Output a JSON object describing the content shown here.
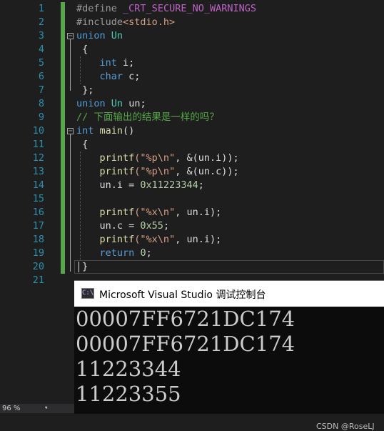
{
  "editor": {
    "line_numbers": [
      "1",
      "2",
      "3",
      "4",
      "5",
      "6",
      "7",
      "8",
      "9",
      "10",
      "11",
      "12",
      "13",
      "14",
      "15",
      "16",
      "17",
      "18",
      "19",
      "20",
      "21"
    ],
    "code": {
      "l1_kw": "#define",
      "l1_macro": "_CRT_SECURE_NO_WARNINGS",
      "l2_kw": "#include",
      "l2_file": "<stdio.h>",
      "l3_kw": "union",
      "l3_name": "Un",
      "l4": "{",
      "l5_type": "int",
      "l5_var": "i;",
      "l6_type": "char",
      "l6_var": "c;",
      "l7": "};",
      "l8_kw": "union",
      "l8_name": "Un",
      "l8_var": "un;",
      "l9_comment": "// 下面输出的结果是一样的吗？",
      "l10_type": "int",
      "l10_fn": "main",
      "l10_rest": "()",
      "l11": "{",
      "l12_fn": "printf",
      "l12_fmt": "(\"%p\\n\"",
      "l12_rest": ", &(un.i));",
      "l13_fn": "printf",
      "l13_fmt": "(\"%p\\n\"",
      "l13_rest": ", &(un.c));",
      "l14_lhs": "un.i = ",
      "l14_num": "0x11223344",
      "l14_end": ";",
      "l16_fn": "printf",
      "l16_fmt": "(\"%x\\n\"",
      "l16_rest": ", un.i);",
      "l17_lhs": "un.c = ",
      "l17_num": "0x55",
      "l17_end": ";",
      "l18_fn": "printf",
      "l18_fmt": "(\"%x\\n\"",
      "l18_rest": ", un.i);",
      "l19_kw": "return",
      "l19_num": "0",
      "l19_end": ";",
      "l20": "}"
    },
    "fold_open_symbol": "−"
  },
  "console": {
    "icon_text": "C:\\",
    "title": "Microsoft Visual Studio 调试控制台",
    "output_lines": [
      "00007FF6721DC174",
      "00007FF6721DC174",
      "11223344",
      "11223355"
    ],
    "watermark": "CSDN @RoseLJ"
  },
  "status": {
    "zoom": "96 %",
    "zoom_caret": "▾"
  },
  "colors": {
    "background": "#1e1e1e",
    "keyword": "#569cd6",
    "type": "#4ec9b0",
    "function": "#dcdcaa",
    "string": "#d69d85",
    "number": "#b5cea8",
    "comment": "#57a64a",
    "line_number": "#2b91af"
  }
}
